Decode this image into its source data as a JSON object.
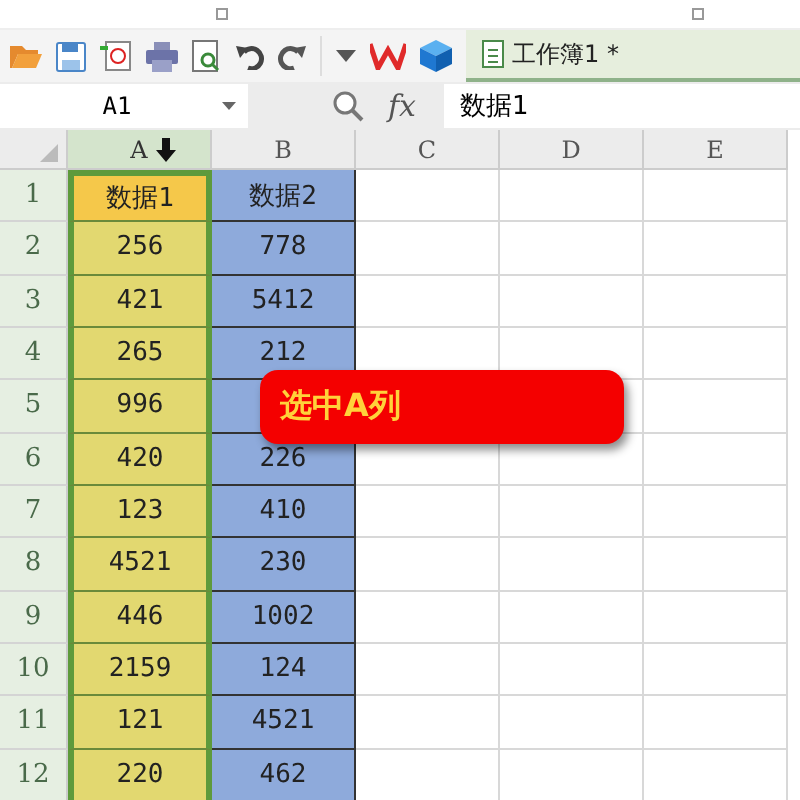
{
  "document_tab": {
    "title": "工作簿1 *",
    "selected": true
  },
  "name_box": {
    "value": "A1"
  },
  "formula_bar": {
    "fx_label": "fx",
    "value": "数据1"
  },
  "columns": [
    {
      "label": "A",
      "selected": true,
      "color": "#e2d870"
    },
    {
      "label": "B",
      "selected": false,
      "color": "#8eaadb"
    },
    {
      "label": "C",
      "selected": false
    },
    {
      "label": "D",
      "selected": false
    },
    {
      "label": "E",
      "selected": false
    }
  ],
  "rows": [
    {
      "number": "1",
      "cells": [
        {
          "text": "数据1",
          "color": "#f5c84a"
        },
        {
          "text": "数据2"
        }
      ]
    },
    {
      "number": "2",
      "cells": [
        {
          "text": "256"
        },
        {
          "text": "778"
        }
      ]
    },
    {
      "number": "3",
      "cells": [
        {
          "text": "421"
        },
        {
          "text": "5412"
        }
      ]
    },
    {
      "number": "4",
      "cells": [
        {
          "text": "265"
        },
        {
          "text": "212"
        }
      ]
    },
    {
      "number": "5",
      "cells": [
        {
          "text": "996"
        },
        {}
      ]
    },
    {
      "number": "6",
      "cells": [
        {
          "text": "420"
        },
        {
          "text": "226"
        }
      ]
    },
    {
      "number": "7",
      "cells": [
        {
          "text": "123"
        },
        {
          "text": "410"
        }
      ]
    },
    {
      "number": "8",
      "cells": [
        {
          "text": "4521"
        },
        {
          "text": "230"
        }
      ]
    },
    {
      "number": "9",
      "cells": [
        {
          "text": "446"
        },
        {
          "text": "1002"
        }
      ]
    },
    {
      "number": "10",
      "cells": [
        {
          "text": "2159"
        },
        {
          "text": "124"
        }
      ]
    },
    {
      "number": "11",
      "cells": [
        {
          "text": "121"
        },
        {
          "text": "4521"
        }
      ]
    },
    {
      "number": "12",
      "cells": [
        {
          "text": "220"
        },
        {
          "text": "462"
        }
      ]
    }
  ],
  "callout": {
    "text": "选中A列"
  }
}
